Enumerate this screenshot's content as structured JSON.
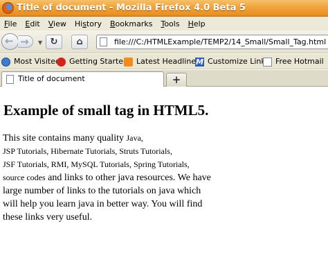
{
  "window": {
    "title": "Title of document - Mozilla Firefox 4.0 Beta 5"
  },
  "menu": [
    {
      "pre": "",
      "u": "F",
      "post": "ile"
    },
    {
      "pre": "",
      "u": "E",
      "post": "dit"
    },
    {
      "pre": "",
      "u": "V",
      "post": "iew"
    },
    {
      "pre": "Hi",
      "u": "s",
      "post": "tory"
    },
    {
      "pre": "",
      "u": "B",
      "post": "ookmarks"
    },
    {
      "pre": "",
      "u": "T",
      "post": "ools"
    },
    {
      "pre": "",
      "u": "H",
      "post": "elp"
    }
  ],
  "nav": {
    "url": "file:///C:/HTMLExample/TEMP2/14_Small/Small_Tag.html"
  },
  "bookmarks": [
    {
      "label": "Most Visited",
      "icon": "most-visited-icon"
    },
    {
      "label": "Getting Started",
      "icon": "getting-started-icon"
    },
    {
      "label": "Latest Headlines",
      "icon": "rss-feed-icon"
    },
    {
      "label": "Customize Links",
      "icon": "msn-icon"
    },
    {
      "label": "Free Hotmail",
      "icon": "page-icon"
    }
  ],
  "tabs": [
    {
      "label": "Title of document"
    }
  ],
  "newtab_label": "+",
  "page": {
    "heading": "Example of small tag in HTML5.",
    "lines": [
      [
        {
          "t": "This site contains many quality ",
          "s": false
        },
        {
          "t": "Java,",
          "s": true
        }
      ],
      [
        {
          "t": "JSP Tutorials, Hibernate Tutorials, Struts Tutorials,",
          "s": true
        }
      ],
      [
        {
          "t": "JSF Tutorials, RMI, MySQL Tutorials, Spring Tutorials,",
          "s": true
        }
      ],
      [
        {
          "t": "source codes",
          "s": true
        },
        {
          "t": " and links to other java resources. We have",
          "s": false
        }
      ],
      [
        {
          "t": "large number of links to the tutorials on java which",
          "s": false
        }
      ],
      [
        {
          "t": "will help you learn java in better way. You will find",
          "s": false
        }
      ],
      [
        {
          "t": "these links very useful.",
          "s": false
        }
      ]
    ]
  }
}
